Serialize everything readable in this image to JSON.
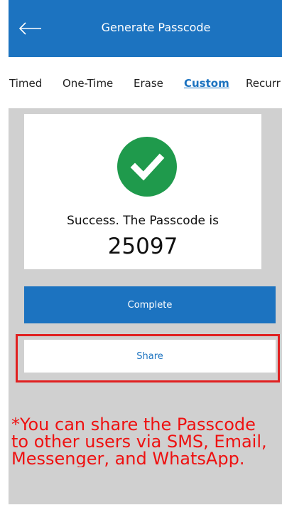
{
  "header": {
    "title": "Generate Passcode",
    "back_icon": "arrow-left-icon"
  },
  "tabs": [
    {
      "label": "Timed",
      "active": false
    },
    {
      "label": "One-Time",
      "active": false
    },
    {
      "label": "Erase",
      "active": false
    },
    {
      "label": "Custom",
      "active": true
    },
    {
      "label": "Recurr",
      "active": false
    }
  ],
  "result": {
    "status_icon": "check-circle-icon",
    "message": "Success. The Passcode is",
    "passcode": "25097"
  },
  "actions": {
    "complete_label": "Complete",
    "share_label": "Share"
  },
  "note": {
    "lines": [
      "*You can share the Passcode",
      "to other users via SMS, Email,",
      "Messenger, and WhatsApp."
    ]
  },
  "colors": {
    "primary": "#1c73c0",
    "success": "#1f9a4c",
    "annotation": "#e02020"
  }
}
